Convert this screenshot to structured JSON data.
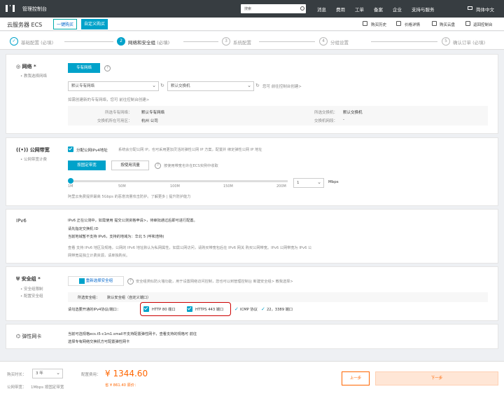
{
  "topbar": {
    "brand": "管理控制台",
    "search_placeholder": "搜索",
    "nav": [
      "消息",
      "费用",
      "工单",
      "备案",
      "企业",
      "支持与服务"
    ],
    "lang": "简体中文"
  },
  "subbar": {
    "title": "云服务器 ECS",
    "tabs": [
      "一键购买",
      "自定义购买"
    ],
    "actions": [
      "购买历史",
      "价格详情",
      "购买云盘",
      "返回控制台"
    ]
  },
  "steps": [
    {
      "num": "✓",
      "label": "基础配置",
      "sub": "(必填)"
    },
    {
      "num": "2",
      "label": "网络和安全组",
      "sub": "(必填)"
    },
    {
      "num": "3",
      "label": "系统配置",
      "sub": ""
    },
    {
      "num": "4",
      "label": "分组设置",
      "sub": ""
    },
    {
      "num": "5",
      "label": "确认订单",
      "sub": "(必填)"
    }
  ],
  "network": {
    "title": "网络 *",
    "sub": "• 教我选择网络",
    "vpc_button": "专有网络",
    "vpc_select": "默认专有网络",
    "vswitch_select": "默认交换机",
    "vswitch_hint": "您可 前往控制台创建>",
    "create_hint": "如需创建新的专有网络，您可 前往控制台创建>",
    "info": {
      "vpc_label": "所选专有网络：",
      "vpc_value": "默认专有网络",
      "zone_label": "交换机所在可用区：",
      "zone_value": "杭州 公司",
      "vswitch_label": "所选交换机：",
      "vswitch_value": "默认交换机",
      "cidr_label": "交换机网段：",
      "cidr_value": "-"
    }
  },
  "bandwidth": {
    "title": "公网带宽",
    "sub": "• 公网带宽计费",
    "assign_label": "分配公网IPv4地址",
    "assign_desc": "系统会分配公网 IP，也可采用更加灵活的弹性公网 IP 方案，配置并 绑定弹性公网 IP 地址",
    "tab_fixed": "按固定带宽",
    "tab_traffic": "按使用流量",
    "tab_hint": "按使用带宽也许在ECS实例中收取",
    "ticks": [
      "1M",
      "50M",
      "100M",
      "150M",
      "200M"
    ],
    "value": "1",
    "unit": "Mbps",
    "note": "阿里云免费提供最高 5Gbps 的恶意流量攻击防护。了解更多 | 提升防护能力"
  },
  "ipv6": {
    "title": "IPv6",
    "line1": "IPv6 正在公测中，如需使用 提交公测资格申请>，待审批通过后即可进行配置。",
    "line2": "请先指定交换机 ID",
    "line3": "当前地域暂不支持 IPv6，支持的地域为：华北 5 (呼和浩特)",
    "line4": "查看 支持 IPv6 地区及规格，公网的 IPv6 地址默认为私网属性，如需公网访问，请购买带宽包后在 IPv6 网关 购买公网带宽。IPv6 公网带宽为 IPv6 公",
    "line5": "网带宽是独立计费资源，请单独购买。"
  },
  "security": {
    "title": "安全组 *",
    "sub1": "• 安全组限制",
    "sub2": "• 配置安全组",
    "reselect": "重新选择安全组",
    "reselect_desc": "安全组类似防火墙功能，用于设置网络访问控制，您也可以到管理控制台 新建安全组> 教我选择>",
    "selected_label": "所选安全组：",
    "selected_value": "默认安全组（自定义端口）",
    "ports_label": "请勾选要开通的IPv4协议/端口：",
    "http": "HTTP 80 端口",
    "https": "HTTPS 443 端口",
    "icmp": "ICMP 协议",
    "ports_other": "22，3389 端口"
  },
  "eni": {
    "title": "弹性网卡",
    "line1": "当前可选规格ecs.t5-c1m1.small不支持配置弹性网卡，查看支持的规格可 前往",
    "line2": "选择专有网络交换机方可配置弹性网卡"
  },
  "bottom": {
    "duration_label": "购买时长：",
    "duration_value": "3 年",
    "bandwidth_label": "公网带宽：",
    "bandwidth_value": "1Mbps 按固定带宽",
    "fee_label": "配置费用：",
    "price": "¥ 1344.60",
    "discount": "省 ¥ 861.40 原价：",
    "prev_button": "上一步",
    "next_button": "下一步"
  }
}
